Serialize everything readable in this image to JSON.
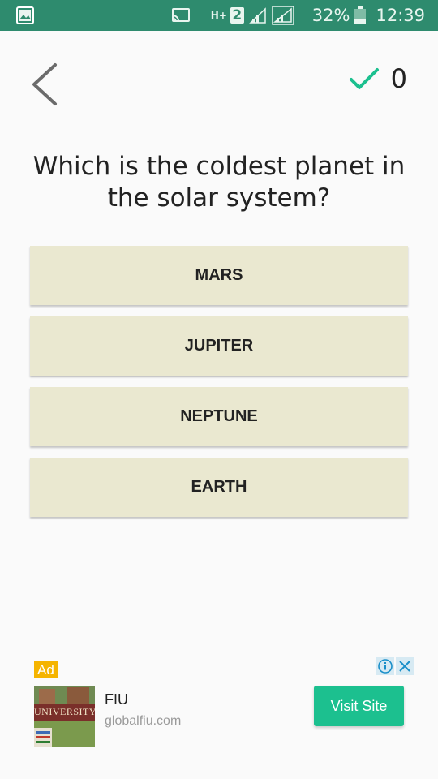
{
  "status_bar": {
    "network_type": "H+",
    "sim_slot": "2",
    "battery_percent": "32%",
    "time": "12:39",
    "icons": [
      "gallery-icon",
      "cast-icon",
      "signal-icon",
      "battery-icon"
    ]
  },
  "header": {
    "back_icon": "chevron-left-icon",
    "score_icon": "checkmark-icon",
    "score": "0",
    "accent_color": "#1cc08f"
  },
  "question": {
    "text": "Which is the coldest planet in the solar system?"
  },
  "answers": [
    {
      "label": "MARS"
    },
    {
      "label": "JUPITER"
    },
    {
      "label": "NEPTUNE"
    },
    {
      "label": "EARTH"
    }
  ],
  "ad": {
    "badge": "Ad",
    "title": "FIU",
    "url": "globalfiu.com",
    "cta": "Visit Site",
    "image_text": "UNIVERSITY",
    "cta_color": "#1cc08f"
  }
}
